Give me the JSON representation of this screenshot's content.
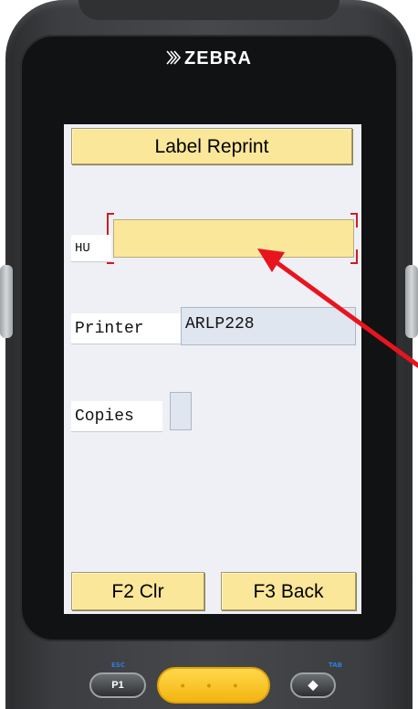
{
  "device": {
    "brand": "ZEBRA"
  },
  "screen": {
    "title": "Label Reprint",
    "fields": {
      "hu": {
        "label": "HU",
        "value": ""
      },
      "printer": {
        "label": "Printer",
        "value": "ARLP228"
      },
      "copies": {
        "label": "Copies",
        "value": ""
      }
    },
    "function_keys": {
      "f2": "F2 Clr",
      "f3": "F3 Back"
    }
  },
  "hardware_buttons": {
    "p1": "P1",
    "esc": "ESC",
    "scan": "• • •",
    "diamond": "◆",
    "tab": "TAB"
  },
  "colors": {
    "field_yellow": "#fbe79a",
    "field_blue": "#dfe6f0",
    "annotation_red": "#e8141e",
    "device_body": "#3b3d40",
    "scan_button": "#f8c52a"
  },
  "icons": {
    "brand_logo": "zebra-logo-icon",
    "annotation": "red-arrow-icon"
  }
}
